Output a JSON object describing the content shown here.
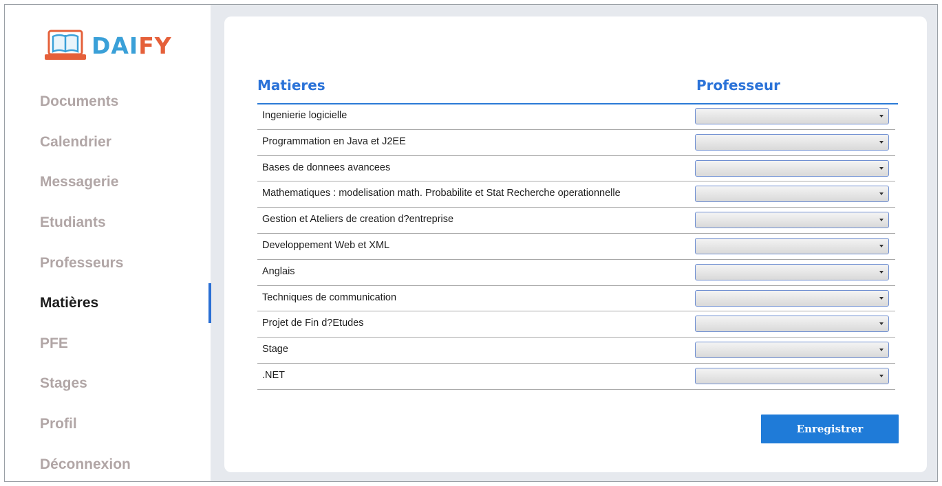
{
  "app": {
    "logo_part1": "DAI",
    "logo_part2": "FY",
    "colors": {
      "logo_blue": "#3aa0d8",
      "logo_orange": "#e5603a",
      "accent": "#2a72d8"
    }
  },
  "sidebar": {
    "items": [
      {
        "label": "Documents",
        "active": false
      },
      {
        "label": "Calendrier",
        "active": false
      },
      {
        "label": "Messagerie",
        "active": false
      },
      {
        "label": "Etudiants",
        "active": false
      },
      {
        "label": "Professeurs",
        "active": false
      },
      {
        "label": "Matières",
        "active": true
      },
      {
        "label": "PFE",
        "active": false
      },
      {
        "label": "Stages",
        "active": false
      },
      {
        "label": "Profil",
        "active": false
      },
      {
        "label": "Déconnexion",
        "active": false
      }
    ]
  },
  "table": {
    "headers": {
      "subject": "Matieres",
      "professor": "Professeur"
    },
    "rows": [
      {
        "subject": "Ingenierie logicielle",
        "professor": ""
      },
      {
        "subject": "Programmation en Java et J2EE",
        "professor": ""
      },
      {
        "subject": "Bases de donnees avancees",
        "professor": ""
      },
      {
        "subject": "Mathematiques : modelisation math. Probabilite et Stat Recherche operationnelle",
        "professor": ""
      },
      {
        "subject": "Gestion et Ateliers de creation d?entreprise",
        "professor": ""
      },
      {
        "subject": "Developpement Web et XML",
        "professor": ""
      },
      {
        "subject": "Anglais",
        "professor": ""
      },
      {
        "subject": "Techniques de communication",
        "professor": ""
      },
      {
        "subject": "Projet de Fin d?Etudes",
        "professor": ""
      },
      {
        "subject": "Stage",
        "professor": ""
      },
      {
        "subject": ".NET",
        "professor": ""
      }
    ]
  },
  "actions": {
    "save_label": "Enregistrer"
  }
}
